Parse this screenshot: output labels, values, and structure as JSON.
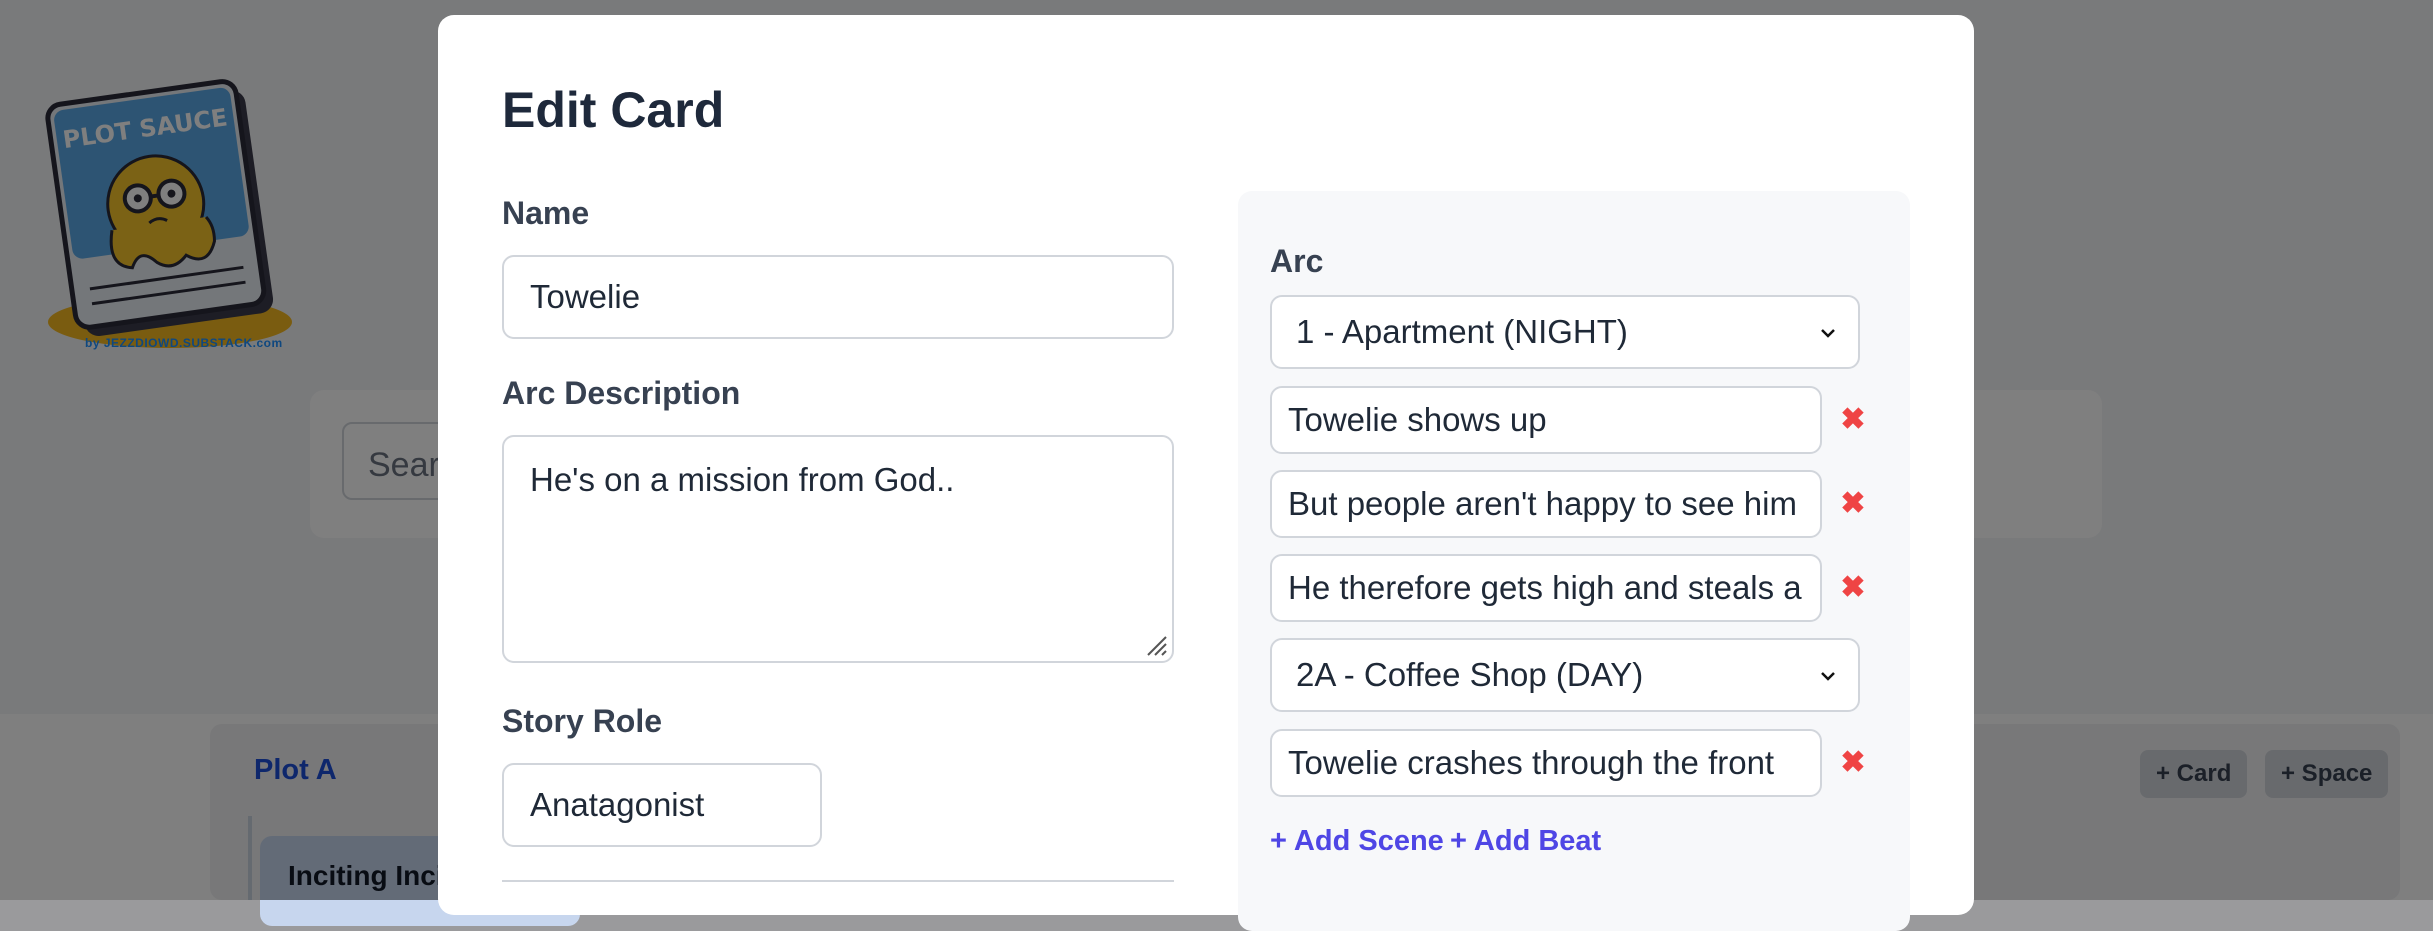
{
  "logo": {
    "title": "PLOT SAUCE",
    "caption": "by JEZZDIOWD.SUBSTACK.com"
  },
  "search": {
    "placeholder": "Search"
  },
  "board": {
    "plot_title": "Plot A",
    "add_card_label": "+ Card",
    "add_space_label": "+ Space",
    "first_card_title": "Inciting Incident"
  },
  "modal": {
    "title": "Edit Card",
    "name_label": "Name",
    "name_value": "Towelie",
    "arc_description_label": "Arc Description",
    "arc_description_value": "He's on a mission from God..",
    "story_role_label": "Story Role",
    "story_role_value": "Anatagonist",
    "arc": {
      "label": "Arc",
      "items": [
        {
          "type": "scene",
          "value": "1 - Apartment (NIGHT)"
        },
        {
          "type": "beat",
          "value": "Towelie shows up"
        },
        {
          "type": "beat",
          "value": "But people aren't happy to see him"
        },
        {
          "type": "beat",
          "value": "He therefore gets high and steals a"
        },
        {
          "type": "scene",
          "value": "2A - Coffee Shop (DAY)"
        },
        {
          "type": "beat",
          "value": "Towelie crashes through the front"
        }
      ],
      "remove_symbol": "✖",
      "add_scene_label": "+ Add Scene",
      "add_beat_label": "+ Add Beat"
    }
  },
  "colors": {
    "overlay": "#000000",
    "primary_text": "#1e293b",
    "link": "#4f46e5",
    "remove": "#ef4444",
    "plot_title": "#1d4ed8"
  }
}
